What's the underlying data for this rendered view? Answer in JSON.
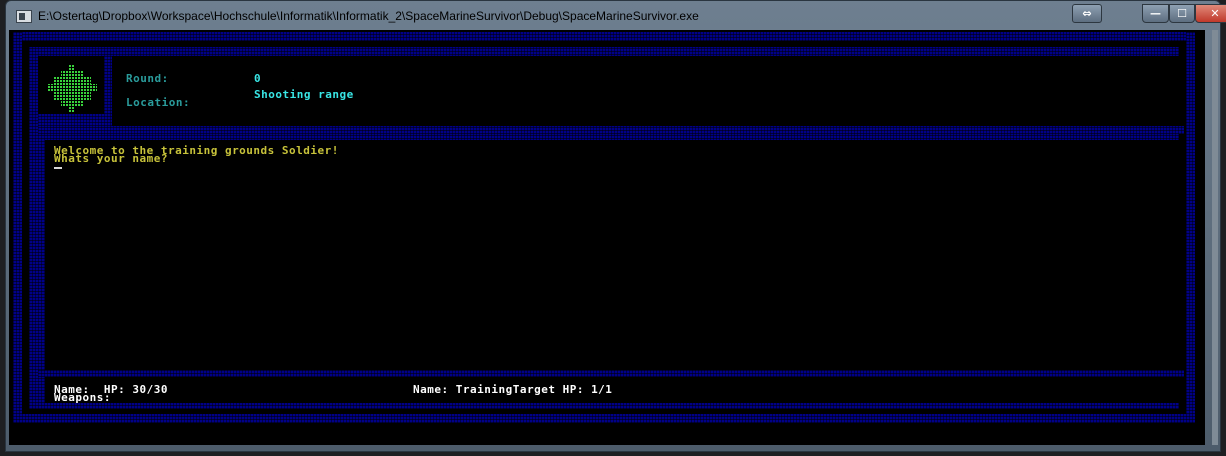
{
  "window": {
    "title": "E:\\Ostertag\\Dropbox\\Workspace\\Hochschule\\Informatik\\Informatik_2\\SpaceMarineSurvivor\\Debug\\SpaceMarineSurvivor.exe",
    "buttons": {
      "minimize": "—",
      "maximize": "☐",
      "close": "✕",
      "resize": "⇔"
    }
  },
  "header": {
    "round_label": "Round:",
    "round_value": "0",
    "location_label": "Location:",
    "location_value": "Shooting range"
  },
  "console": {
    "lines": [
      "Welcome to the training grounds Soldier!",
      "Whats your name?"
    ]
  },
  "footer": {
    "player_line": "Name:  HP: 30/30",
    "weapons_line": "Weapons:",
    "enemy_line": "Name: TrainingTarget HP: 1/1"
  },
  "colors": {
    "frame_blue": "#000088",
    "label_teal": "#2a9c9c",
    "value_cyan": "#39e6e6",
    "text_yellow": "#c7c23a",
    "portrait_green": "#39d23c"
  },
  "icons": {
    "portrait": "pixel-marine-portrait-icon",
    "app": "console-app-icon"
  }
}
